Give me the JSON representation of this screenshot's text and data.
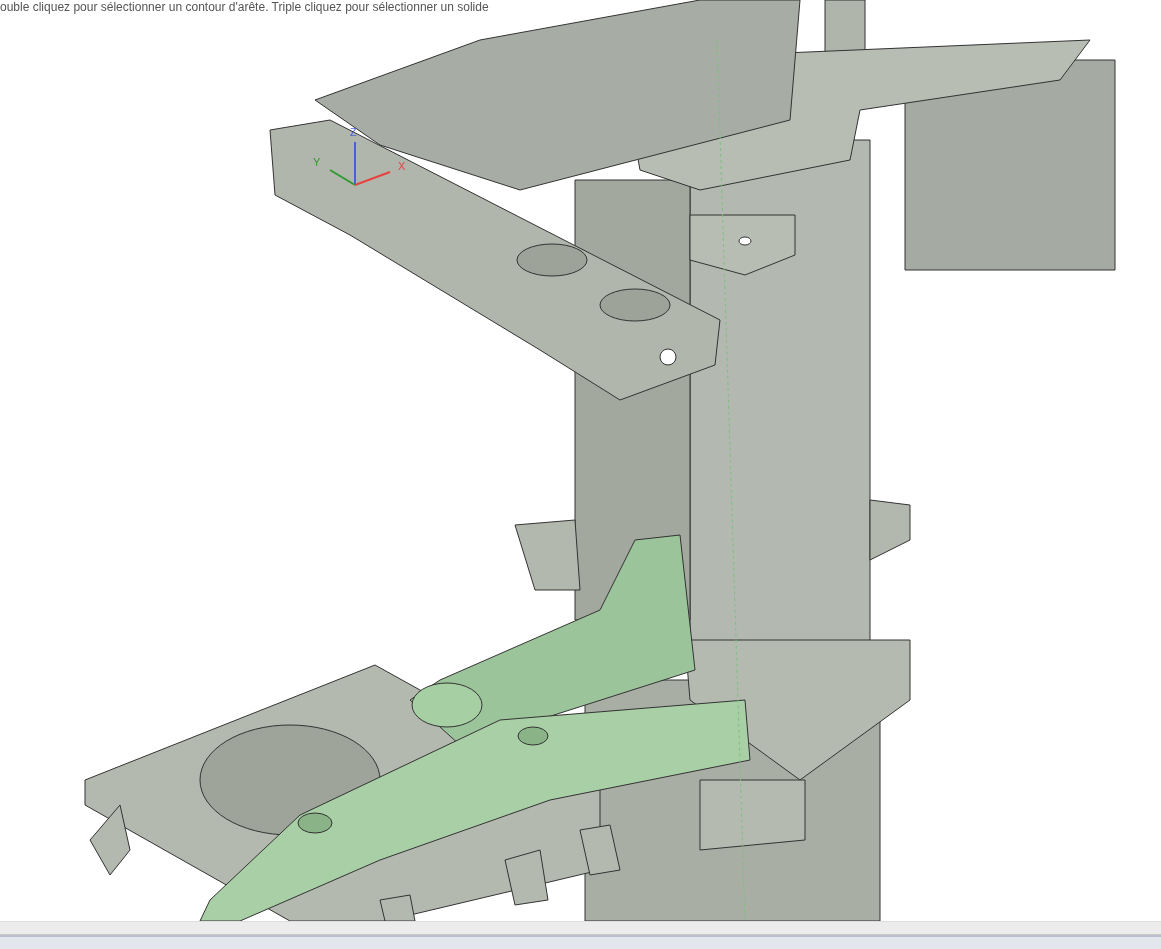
{
  "viewport": {
    "hint": "ouble cliquez pour sélectionner un contour d'arête. Triple cliquez pour sélectionner un solide",
    "axes": [
      {
        "label": "X",
        "color": "#e8423f"
      },
      {
        "label": "Y",
        "color": "#2f9a2f"
      },
      {
        "label": "Z",
        "color": "#4a5fe0"
      }
    ]
  }
}
